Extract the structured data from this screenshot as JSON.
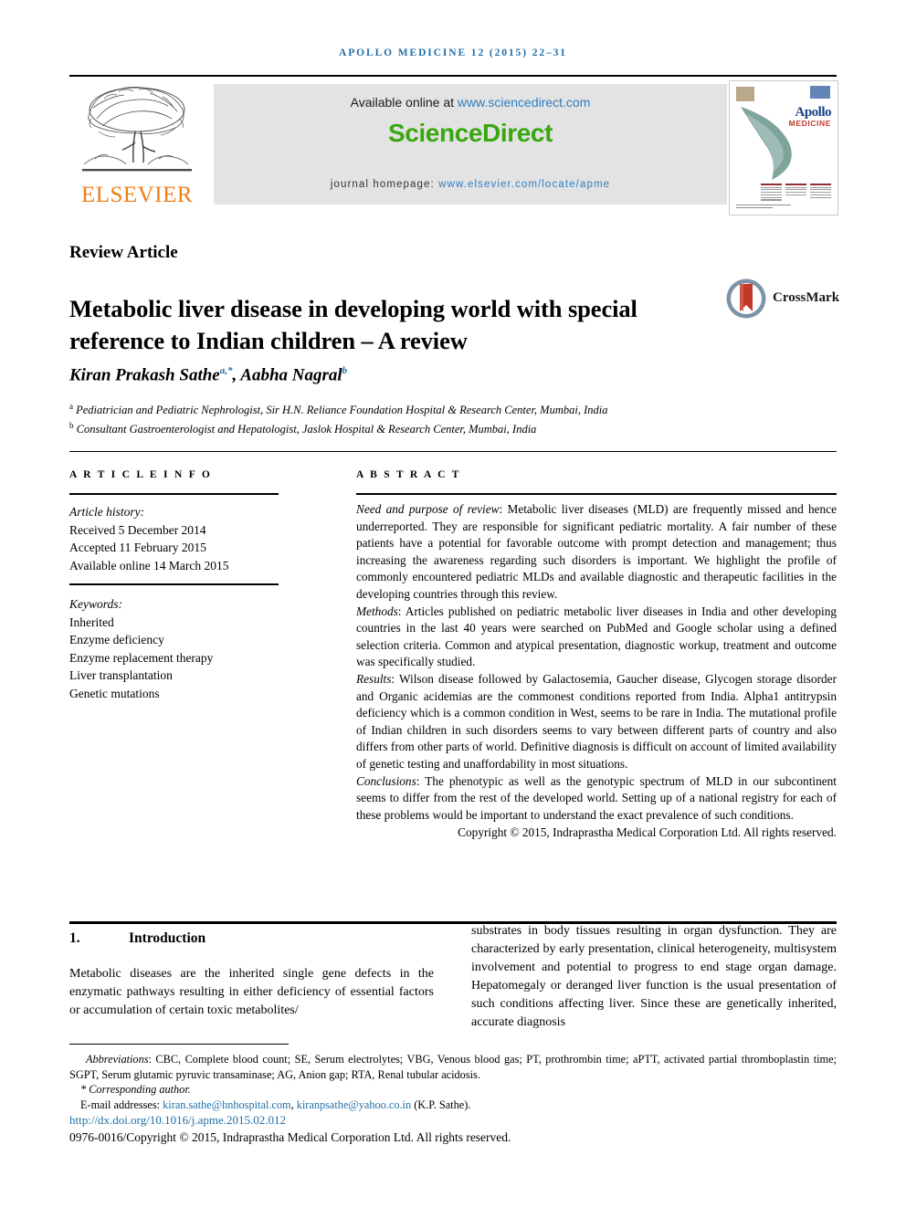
{
  "running_head": "APOLLO MEDICINE 12 (2015) 22–31",
  "masthead": {
    "publisher_name": "ELSEVIER",
    "available_prefix": "Available online at ",
    "available_link": "www.sciencedirect.com",
    "sciencedirect_logo": "ScienceDirect",
    "homepage_prefix": "journal homepage: ",
    "homepage_link": "www.elsevier.com/locate/apme",
    "cover": {
      "journal_name": "Apollo",
      "journal_subtitle": "MEDICINE"
    },
    "colors": {
      "elsevier_orange": "#f07d17",
      "sciencedirect_green": "#3aa711",
      "link_blue": "#2f7fc1",
      "banner_gray": "#e3e3e3"
    }
  },
  "article": {
    "type": "Review Article",
    "title": "Metabolic liver disease in developing world with special reference to Indian children – A review",
    "crossmark_label": "CrossMark",
    "authors": "Kiran Prakash Sathe",
    "author_1_sup": "a,*",
    "authors_2": ", Aabha Nagral",
    "author_2_sup": "b",
    "affiliation_a_sup": "a",
    "affiliation_a": " Pediatrician and Pediatric Nephrologist, Sir H.N. Reliance Foundation Hospital & Research Center, Mumbai, India",
    "affiliation_b_sup": "b",
    "affiliation_b": " Consultant Gastroenterologist and Hepatologist, Jaslok Hospital & Research Center, Mumbai, India"
  },
  "info": {
    "header": "A R T I C L E   I N F O",
    "history_label": "Article history:",
    "received": "Received 5 December 2014",
    "accepted": "Accepted 11 February 2015",
    "available": "Available online 14 March 2015",
    "keywords_label": "Keywords:",
    "keywords": [
      "Inherited",
      "Enzyme deficiency",
      "Enzyme replacement therapy",
      "Liver transplantation",
      "Genetic mutations"
    ]
  },
  "abstract": {
    "header": "A B S T R A C T",
    "sections": [
      {
        "label": "Need and purpose of review",
        "text": ": Metabolic liver diseases (MLD) are frequently missed and hence underreported. They are responsible for significant pediatric mortality. A fair number of these patients have a potential for favorable outcome with prompt detection and management; thus increasing the awareness regarding such disorders is important. We highlight the profile of commonly encountered pediatric MLDs and available diagnostic and therapeutic facilities in the developing countries through this review."
      },
      {
        "label": "Methods",
        "text": ": Articles published on pediatric metabolic liver diseases in India and other developing countries in the last 40 years were searched on PubMed and Google scholar using a defined selection criteria. Common and atypical presentation, diagnostic workup, treatment and outcome was specifically studied."
      },
      {
        "label": "Results",
        "text": ": Wilson disease followed by Galactosemia, Gaucher disease, Glycogen storage disorder and Organic acidemias are the commonest conditions reported from India. Alpha1 antitrypsin deficiency which is a common condition in West, seems to be rare in India. The mutational profile of Indian children in such disorders seems to vary between different parts of country and also differs from other parts of world. Definitive diagnosis is difficult on account of limited availability of genetic testing and unaffordability in most situations."
      },
      {
        "label": "Conclusions",
        "text": ": The phenotypic as well as the genotypic spectrum of MLD in our subcontinent seems to differ from the rest of the developed world. Setting up of a national registry for each of these problems would be important to understand the exact prevalence of such conditions."
      }
    ],
    "copyright": "Copyright © 2015, Indraprastha Medical Corporation Ltd. All rights reserved."
  },
  "body": {
    "section_number": "1.",
    "section_title": "Introduction",
    "left_column": "Metabolic diseases are the inherited single gene defects in the enzymatic pathways resulting in either deficiency of essential factors or accumulation of certain toxic metabolites/",
    "right_column": "substrates in body tissues resulting in organ dysfunction. They are characterized by early presentation, clinical heterogeneity, multisystem involvement and potential to progress to end stage organ damage. Hepatomegaly or deranged liver function is the usual presentation of such conditions affecting liver. Since these are genetically inherited, accurate diagnosis"
  },
  "footnotes": {
    "abbreviations_label": "Abbreviations",
    "abbreviations_text": ": CBC, Complete blood count; SE, Serum electrolytes; VBG, Venous blood gas; PT, prothrombin time; aPTT, activated partial thromboplastin time; SGPT, Serum glutamic pyruvic transaminase; AG, Anion gap; RTA, Renal tubular acidosis.",
    "corresponding_marker": "*",
    "corresponding_author": "Corresponding author.",
    "email_label": "E-mail addresses: ",
    "email_1": "kiran.sathe@hnhospital.com",
    "email_sep": ", ",
    "email_2": "kiranpsathe@yahoo.co.in",
    "email_suffix": " (K.P. Sathe).",
    "doi": "http://dx.doi.org/10.1016/j.apme.2015.02.012",
    "issn_copyright": "0976-0016/Copyright © 2015, Indraprastha Medical Corporation Ltd. All rights reserved."
  }
}
